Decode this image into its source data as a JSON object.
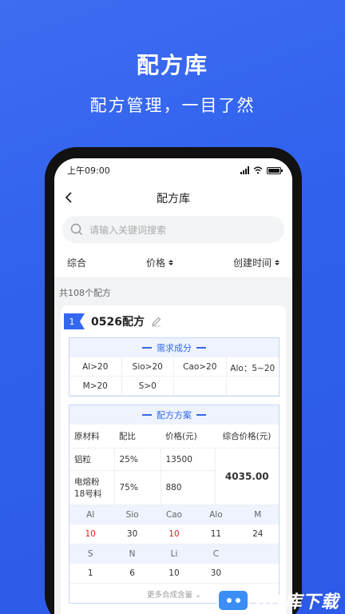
{
  "promo": {
    "title": "配方库",
    "subtitle": "配方管理，一目了然"
  },
  "status": {
    "time": "上午09:00"
  },
  "nav": {
    "title": "配方库"
  },
  "search": {
    "placeholder": "请输入关键词搜索"
  },
  "filters": {
    "comprehensive": "综合",
    "price": "价格",
    "created": "创建时间"
  },
  "list": {
    "count_text": "共108个配方"
  },
  "card": {
    "index": "1",
    "name": "0526配方",
    "requirements": {
      "title": "需求成分",
      "items": [
        "Al>20",
        "Sio>20",
        "Cao>20",
        "Alo：5~20",
        "M>20",
        "S>0",
        "",
        ""
      ]
    },
    "plan": {
      "title": "配方方案",
      "headers": [
        "原材料",
        "配比",
        "价格(元)",
        "综合价格(元)"
      ],
      "rows": [
        {
          "material": "铝粒",
          "ratio": "25%",
          "price": "13500"
        },
        {
          "material": "电熔粉18号料",
          "ratio": "75%",
          "price": "880"
        }
      ],
      "total": "4035.00"
    },
    "elements1": {
      "headers": [
        "Al",
        "Sio",
        "Cao",
        "Alo",
        "M"
      ],
      "values": [
        "10",
        "30",
        "10",
        "11",
        "24"
      ]
    },
    "elements2": {
      "headers": [
        "S",
        "N",
        "Li",
        "C",
        ""
      ],
      "values": [
        "1",
        "6",
        "10",
        "30",
        ""
      ]
    },
    "more": "更多合成含量"
  },
  "watermark": {
    "text": "8D库下载"
  },
  "colors": {
    "primary": "#3468f0",
    "highlight": "#e02020"
  }
}
